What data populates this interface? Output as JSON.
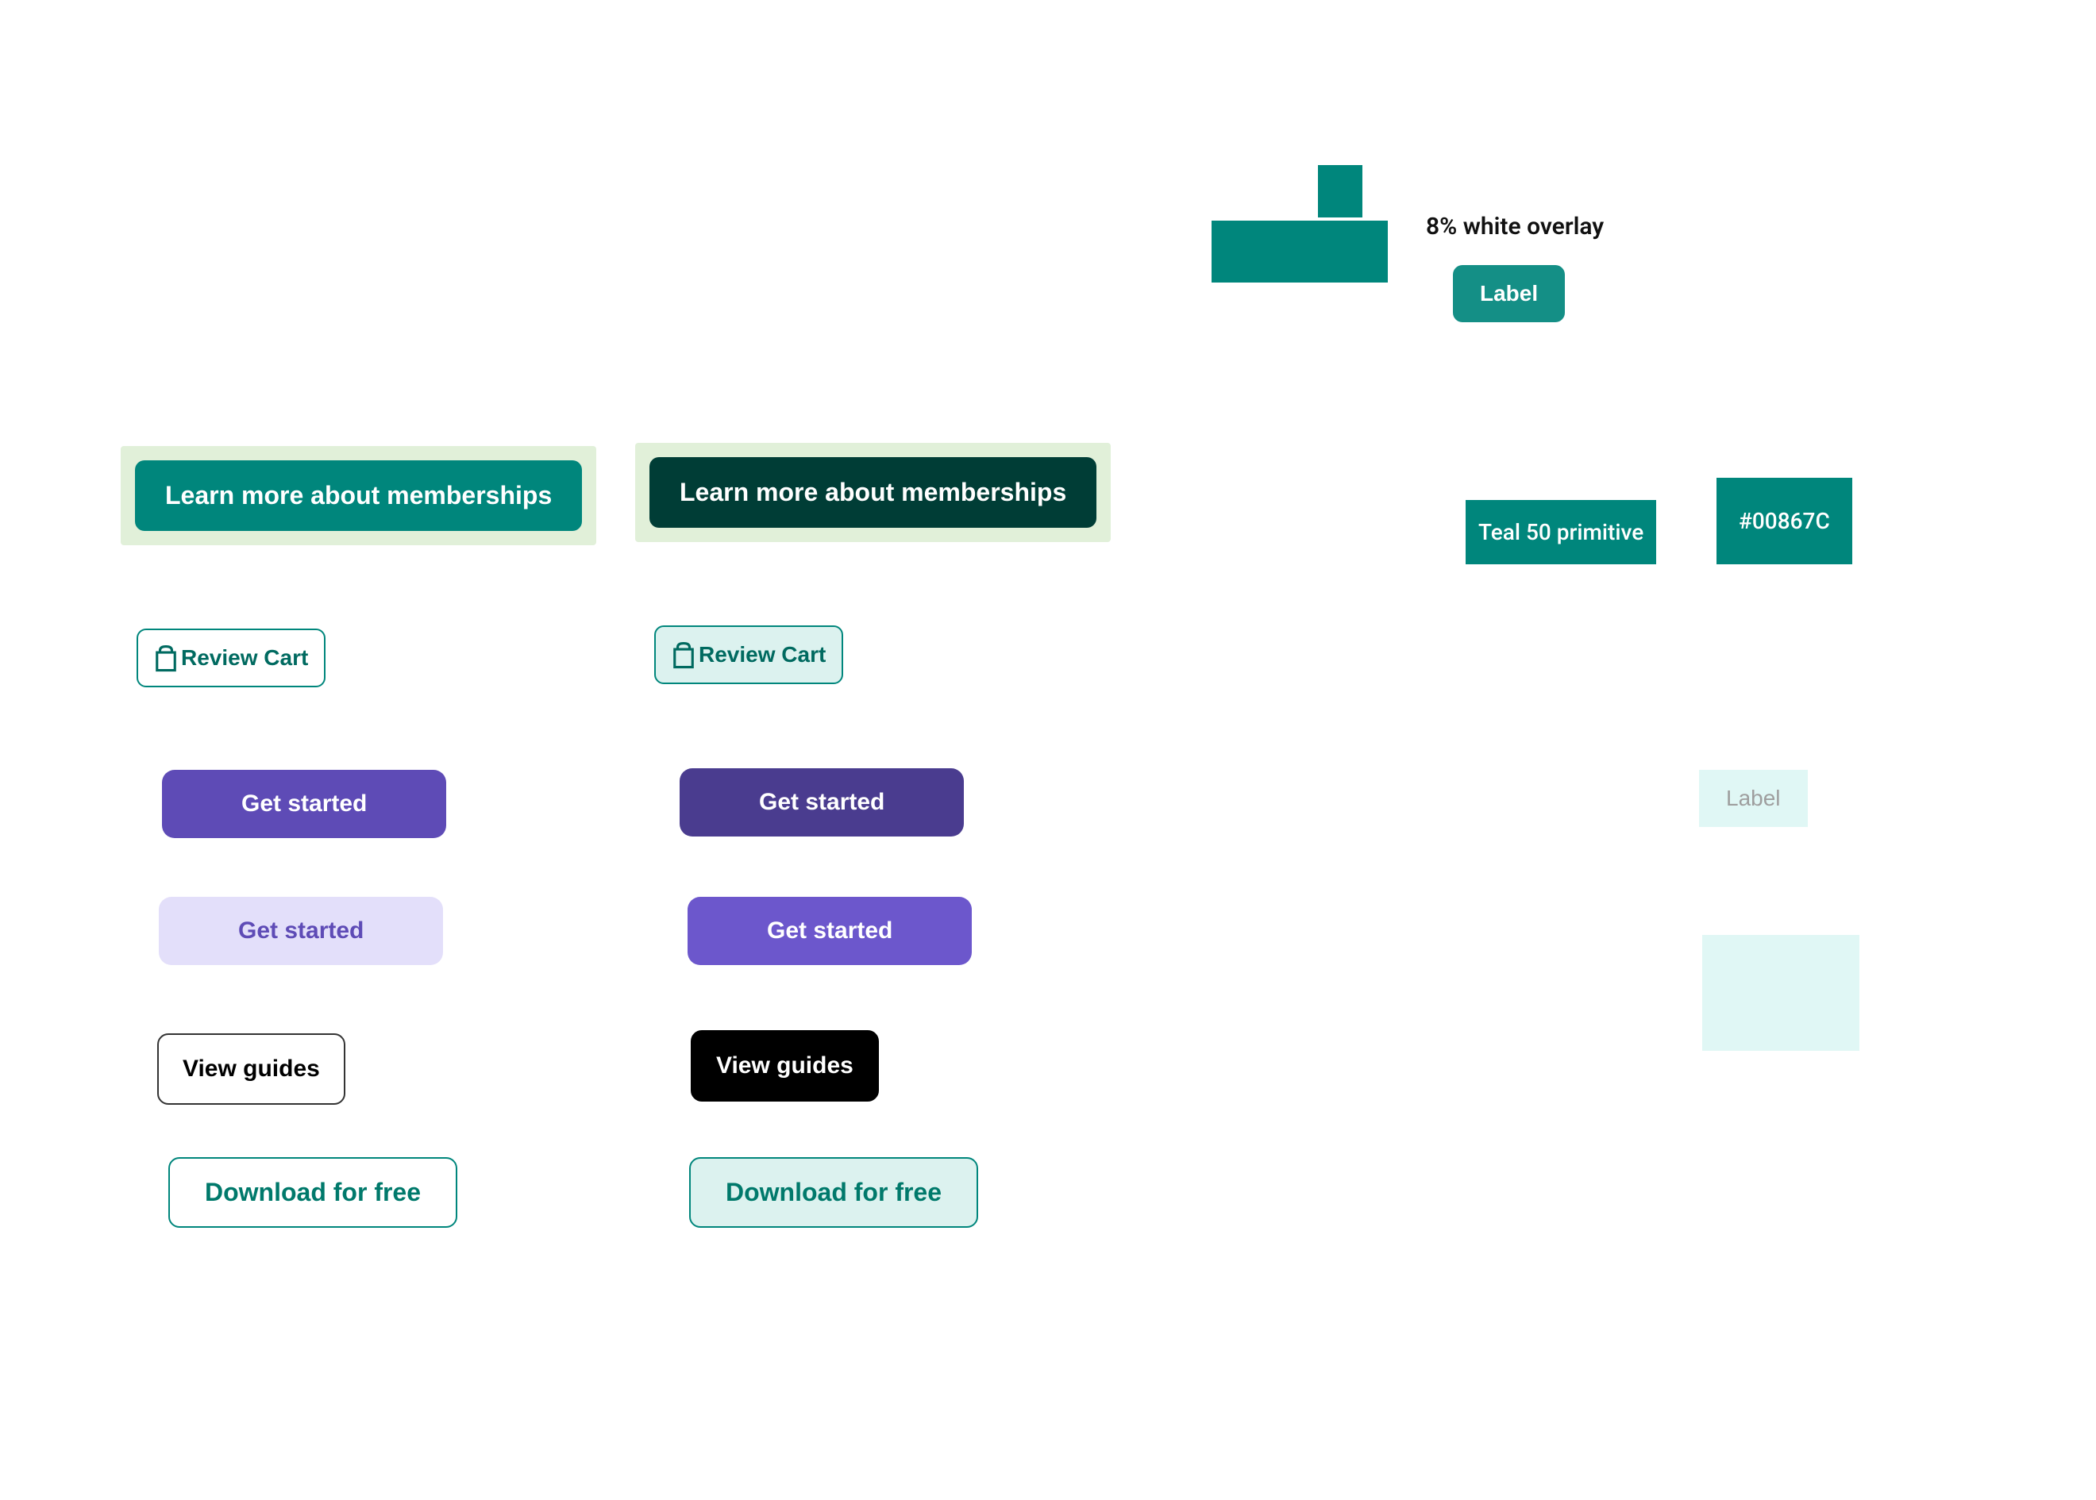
{
  "overlay_text": "8% white overlay",
  "label_button": "Label",
  "teal_primitive": "Teal 50 primitive",
  "hex_value": "#00867C",
  "pale_label": "Label",
  "membership_label": "Learn more about memberships",
  "review_cart_label": "Review Cart",
  "get_started_label": "Get started",
  "view_guides_label": "View guides",
  "download_label": "Download for free",
  "colors": {
    "teal": "#00867C",
    "teal_dark": "#003D36",
    "purple": "#5E4BB6",
    "purple_dark": "#4A3C8F",
    "purple_medium": "#6C57CC",
    "purple_light": "#E3DFFA",
    "pale_teal": "#E0F7F5",
    "pale_green": "#E1F0D9"
  }
}
